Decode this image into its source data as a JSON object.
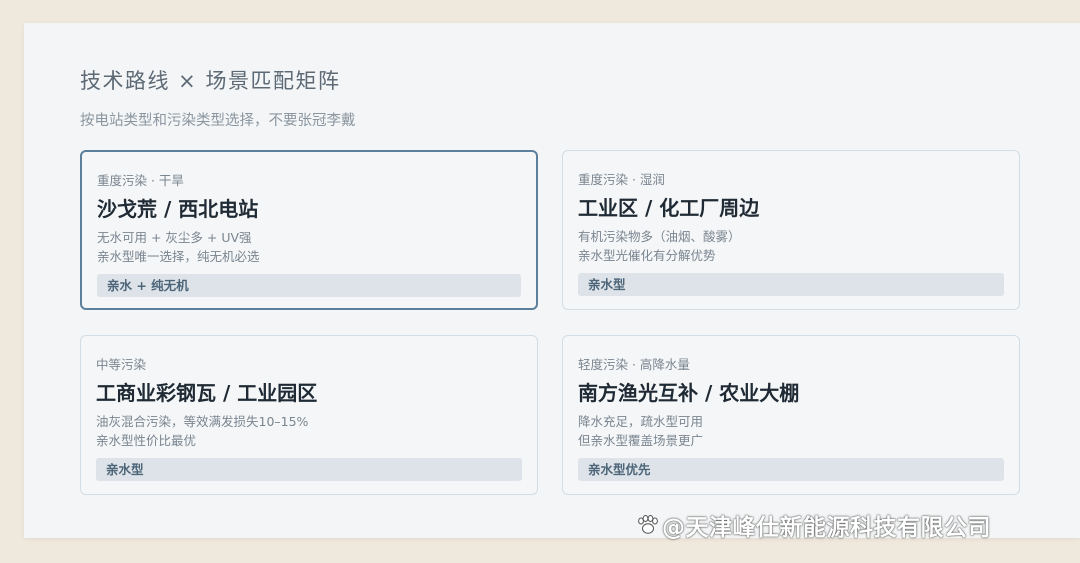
{
  "header": {
    "title": "技术路线 × 场景匹配矩阵",
    "subtitle": "按电站类型和污染类型选择，不要张冠李戴"
  },
  "cards": [
    {
      "tag": "重度污染 · 干旱",
      "name": "沙戈荒 / 西北电站",
      "desc1": "无水可用 + 灰尘多 + UV强",
      "desc2": "亲水型唯一选择，纯无机必选",
      "badge": "亲水 + 纯无机"
    },
    {
      "tag": "重度污染 · 湿润",
      "name": "工业区 / 化工厂周边",
      "desc1": "有机污染物多（油烟、酸雾）",
      "desc2": "亲水型光催化有分解优势",
      "badge": "亲水型"
    },
    {
      "tag": "中等污染",
      "name": "工商业彩钢瓦 / 工业园区",
      "desc1": "油灰混合污染，等效满发损失10–15%",
      "desc2": "亲水型性价比最优",
      "badge": "亲水型"
    },
    {
      "tag": "轻度污染 · 高降水量",
      "name": "南方渔光互补 / 农业大棚",
      "desc1": "降水充足，疏水型可用",
      "desc2": "但亲水型覆盖场景更广",
      "badge": "亲水型优先"
    }
  ],
  "watermark": {
    "text": "@天津峰仕新能源科技有限公司",
    "icon": "paw-icon"
  }
}
